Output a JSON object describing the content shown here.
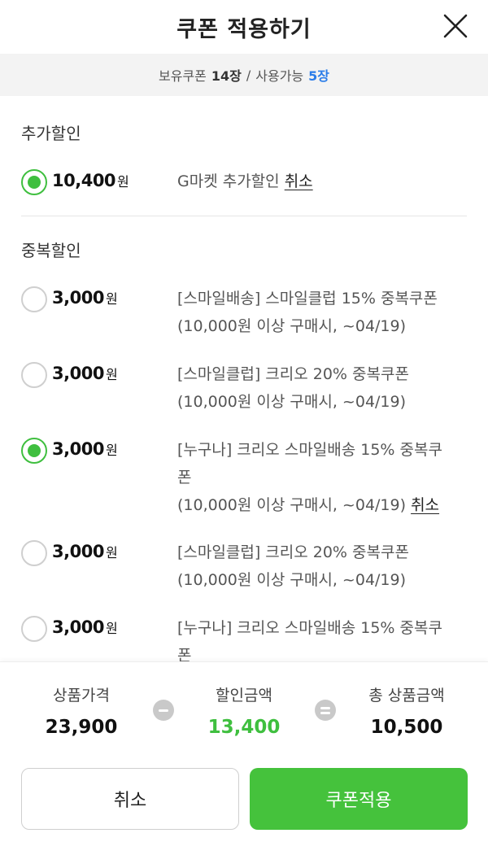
{
  "header": {
    "title": "쿠폰 적용하기"
  },
  "summary": {
    "owned_label": "보유쿠폰",
    "owned_count": "14장",
    "separator": "/",
    "usable_label": "사용가능",
    "usable_count": "5장"
  },
  "extra_discount": {
    "title": "추가할인",
    "items": [
      {
        "amount": "10,400",
        "unit": "원",
        "desc": "G마켓 추가할인",
        "cancel": "취소",
        "selected": true
      }
    ]
  },
  "duplicate_discount": {
    "title": "중복할인",
    "items": [
      {
        "amount": "3,000",
        "unit": "원",
        "line1": "[스마일배송] 스마일클럽 15% 중복쿠폰",
        "line2": "(10,000원 이상 구매시, ~04/19)",
        "selected": false
      },
      {
        "amount": "3,000",
        "unit": "원",
        "line1": "[스마일클럽] 크리오 20% 중복쿠폰",
        "line2": "(10,000원 이상 구매시, ~04/19)",
        "selected": false
      },
      {
        "amount": "3,000",
        "unit": "원",
        "line1a": "[누구나] 크리오 스마일배송 15% 중복쿠",
        "line1b": "폰",
        "line2": "(10,000원 이상 구매시, ~04/19)",
        "cancel": "취소",
        "selected": true
      },
      {
        "amount": "3,000",
        "unit": "원",
        "line1": "[스마일클럽] 크리오 20% 중복쿠폰",
        "line2": "(10,000원 이상 구매시, ~04/19)",
        "selected": false
      },
      {
        "amount": "3,000",
        "unit": "원",
        "line1a": "[누구나] 크리오 스마일배송 15% 중복쿠",
        "line1b": "폰",
        "selected": false
      }
    ]
  },
  "footer": {
    "product_price_label": "상품가격",
    "product_price": "23,900",
    "discount_label": "할인금액",
    "discount": "13,400",
    "total_label": "총 상품금액",
    "total": "10,500",
    "cancel_button": "취소",
    "apply_button": "쿠폰적용"
  },
  "colors": {
    "accent_green": "#45c23c",
    "blue": "#2b7de9"
  }
}
